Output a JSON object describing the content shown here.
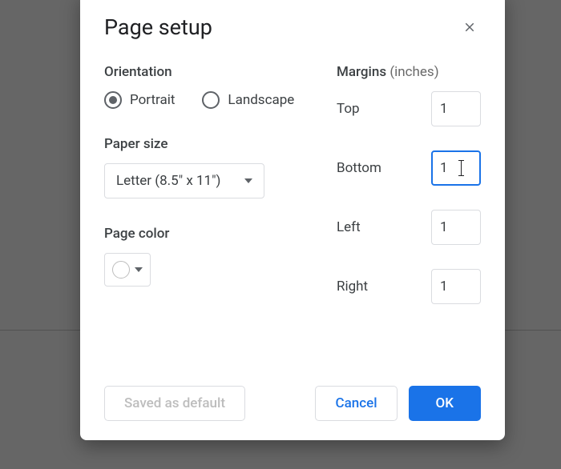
{
  "dialog": {
    "title": "Page setup",
    "orientation": {
      "label": "Orientation",
      "options": {
        "portrait": "Portrait",
        "landscape": "Landscape"
      },
      "selected": "portrait"
    },
    "paperSize": {
      "label": "Paper size",
      "value": "Letter (8.5\" x 11\")"
    },
    "pageColor": {
      "label": "Page color",
      "value": "#ffffff"
    },
    "margins": {
      "label": "Margins",
      "unitsSuffix": "(inches)",
      "top": {
        "label": "Top",
        "value": "1"
      },
      "bottom": {
        "label": "Bottom",
        "value": "1"
      },
      "left": {
        "label": "Left",
        "value": "1"
      },
      "right": {
        "label": "Right",
        "value": "1"
      },
      "focused": "bottom"
    },
    "footer": {
      "savedDefault": "Saved as default",
      "cancel": "Cancel",
      "ok": "OK"
    }
  }
}
